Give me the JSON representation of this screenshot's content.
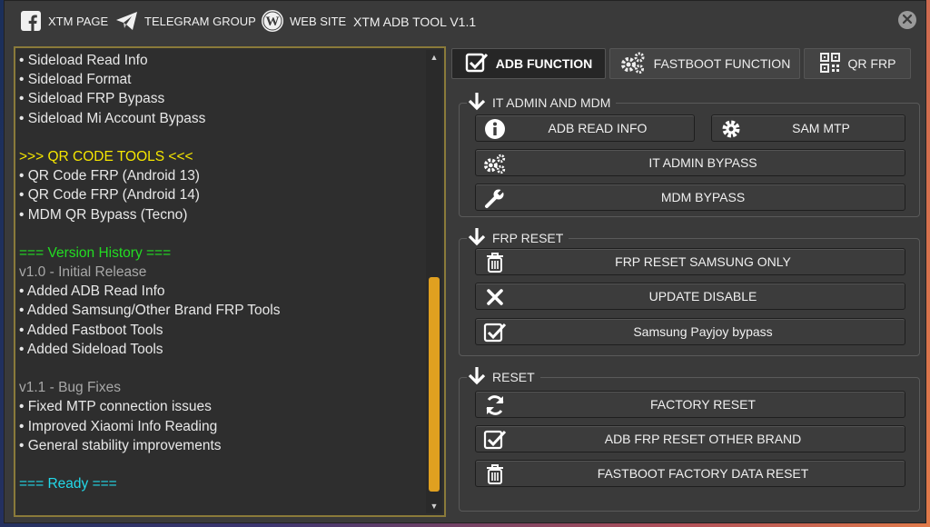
{
  "titlebar": {
    "facebook_label": "XTM PAGE",
    "telegram_label": "TELEGRAM GROUP",
    "website_label": "WEB SITE",
    "app_title": "XTM ADB TOOL V1.1"
  },
  "log": {
    "lines": [
      {
        "text": "• Sideload Read Info",
        "color": "#e8e8e8"
      },
      {
        "text": "• Sideload Format",
        "color": "#e8e8e8"
      },
      {
        "text": "• Sideload FRP Bypass",
        "color": "#e8e8e8"
      },
      {
        "text": "• Sideload Mi Account Bypass",
        "color": "#e8e8e8"
      },
      {
        "text": "",
        "color": "#e8e8e8"
      },
      {
        "text": ">>> QR CODE TOOLS <<<",
        "color": "#f5e600"
      },
      {
        "text": "• QR Code FRP (Android 13)",
        "color": "#e8e8e8"
      },
      {
        "text": "• QR Code FRP (Android 14)",
        "color": "#e8e8e8"
      },
      {
        "text": "• MDM QR Bypass (Tecno)",
        "color": "#e8e8e8"
      },
      {
        "text": "",
        "color": "#e8e8e8"
      },
      {
        "text": "=== Version History ===",
        "color": "#22dd22"
      },
      {
        "text": "v1.0 - Initial Release",
        "color": "#a8a8a8"
      },
      {
        "text": "• Added ADB Read Info",
        "color": "#e8e8e8"
      },
      {
        "text": "• Added Samsung/Other Brand FRP Tools",
        "color": "#e8e8e8"
      },
      {
        "text": "• Added Fastboot Tools",
        "color": "#e8e8e8"
      },
      {
        "text": "• Added Sideload Tools",
        "color": "#e8e8e8"
      },
      {
        "text": "",
        "color": "#e8e8e8"
      },
      {
        "text": "v1.1 - Bug Fixes",
        "color": "#a8a8a8"
      },
      {
        "text": "• Fixed MTP connection issues",
        "color": "#e8e8e8"
      },
      {
        "text": "• Improved Xiaomi Info Reading",
        "color": "#e8e8e8"
      },
      {
        "text": "• General stability improvements",
        "color": "#e8e8e8"
      },
      {
        "text": "",
        "color": "#e8e8e8"
      },
      {
        "text": "=== Ready ===",
        "color": "#22d8e8"
      }
    ]
  },
  "tabs": [
    {
      "label": "ADB FUNCTION",
      "icon": "checkbox-icon",
      "active": true
    },
    {
      "label": "FASTBOOT FUNCTION",
      "icon": "gears-icon",
      "active": false
    },
    {
      "label": "QR FRP",
      "icon": "qr-code-icon",
      "active": false
    }
  ],
  "groups": {
    "it_admin": {
      "title": "IT ADMIN AND MDM",
      "buttons": {
        "adb_read_info": "ADB READ INFO",
        "sam_mtp": "SAM MTP",
        "it_admin_bypass": "IT ADMIN BYPASS",
        "mdm_bypass": "MDM BYPASS"
      }
    },
    "frp_reset": {
      "title": "FRP RESET",
      "buttons": {
        "frp_reset_samsung": "FRP RESET SAMSUNG ONLY",
        "update_disable": "UPDATE DISABLE",
        "samsung_payjoy": "Samsung Payjoy bypass"
      }
    },
    "reset": {
      "title": "RESET",
      "buttons": {
        "factory_reset": "FACTORY RESET",
        "adb_frp_other": "ADB FRP RESET OTHER BRAND",
        "fastboot_factory": "FASTBOOT FACTORY DATA RESET"
      }
    }
  },
  "colors": {
    "accent_scroll": "#e0a020",
    "qr_tools": "#f5e600",
    "version_history": "#22dd22",
    "ready": "#22d8e8",
    "muted": "#a8a8a8"
  }
}
